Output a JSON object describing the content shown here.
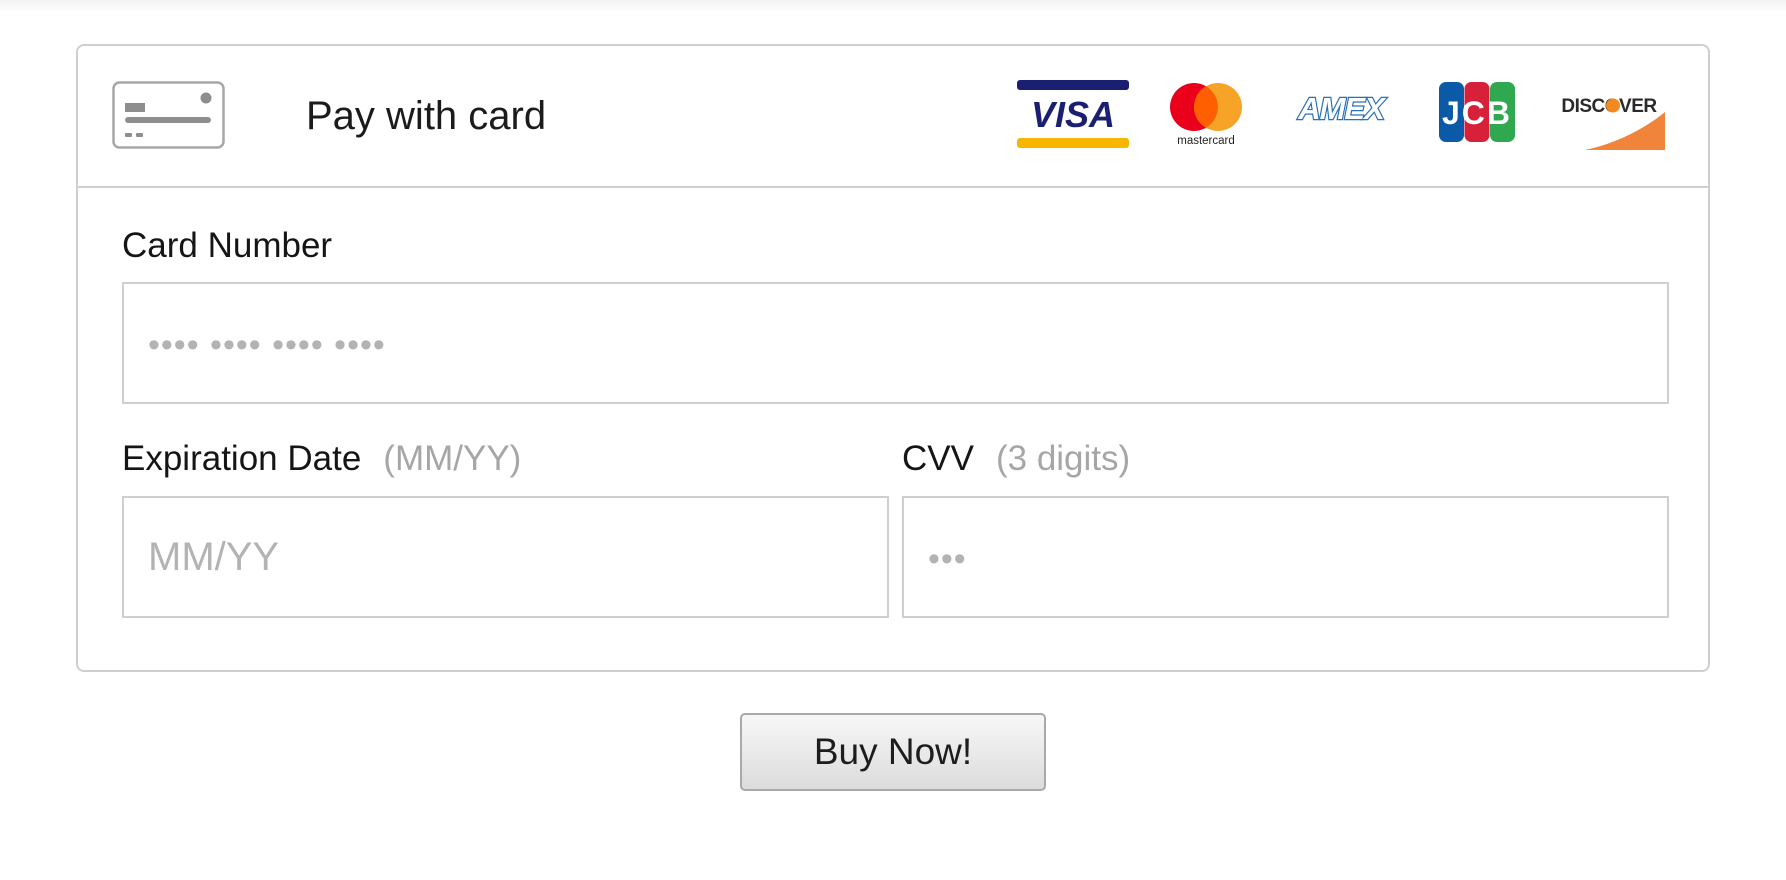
{
  "header": {
    "title": "Pay with card",
    "card_icon": "credit-card-icon",
    "brands": [
      {
        "name": "VISA",
        "icon": "visa-logo",
        "color": "#1a1f71",
        "accent": "#f7b600"
      },
      {
        "name": "mastercard",
        "icon": "mastercard-logo",
        "color": "#eb001b",
        "accent": "#f79e1b"
      },
      {
        "name": "AMEX",
        "icon": "amex-logo",
        "color": "#2671b9"
      },
      {
        "name": "JCB",
        "icon": "jcb-logo",
        "colors": [
          "#0b5aa8",
          "#d7203a",
          "#2fa84f"
        ]
      },
      {
        "name": "DISCOVER",
        "icon": "discover-logo",
        "accent": "#f0843a"
      }
    ]
  },
  "form": {
    "card_number": {
      "label": "Card Number",
      "placeholder": "•••• •••• •••• ••••",
      "value": ""
    },
    "expiration": {
      "label": "Expiration Date",
      "hint": "(MM/YY)",
      "placeholder": "MM/YY",
      "value": ""
    },
    "cvv": {
      "label": "CVV",
      "hint": "(3 digits)",
      "placeholder": "•••",
      "value": ""
    }
  },
  "actions": {
    "buy_label": "Buy Now!"
  },
  "colors": {
    "border": "#cfcfcf",
    "hint": "#a6a6a6",
    "placeholder": "#b3b3b3"
  }
}
